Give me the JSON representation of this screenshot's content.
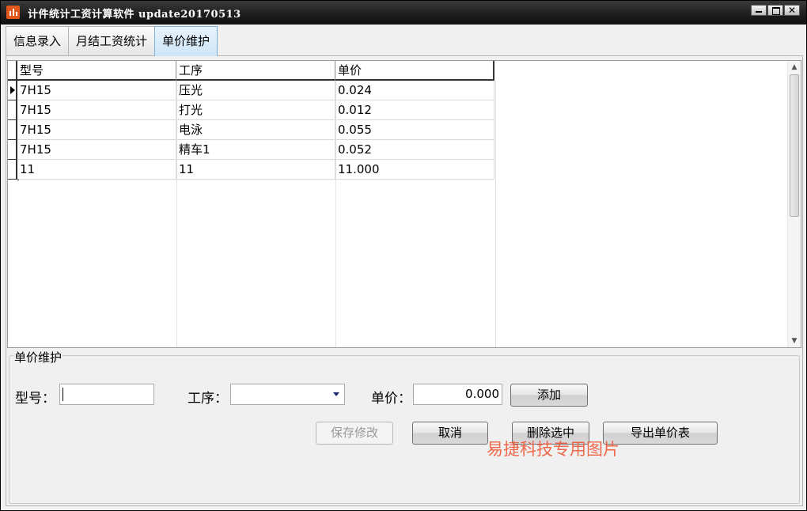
{
  "window": {
    "title": "计件统计工资计算软件  update20170513"
  },
  "tabs": [
    {
      "label": "信息录入",
      "active": false
    },
    {
      "label": "月结工资统计",
      "active": false
    },
    {
      "label": "单价维护",
      "active": true
    }
  ],
  "grid": {
    "columns": [
      "型号",
      "工序",
      "单价"
    ],
    "rows": [
      [
        "7H15",
        "压光",
        "0.024"
      ],
      [
        "7H15",
        "打光",
        "0.012"
      ],
      [
        "7H15",
        "电泳",
        "0.055"
      ],
      [
        "7H15",
        "精车1",
        "0.052"
      ],
      [
        "11",
        "11",
        "11.000"
      ]
    ],
    "current_row_index": 0
  },
  "form": {
    "group_title": "单价维护",
    "model_label": "型号：",
    "model_value": "",
    "process_label": "工序：",
    "process_value": "",
    "price_label": "单价：",
    "price_value": "0.000",
    "add_button": "添加",
    "save_button": "保存修改",
    "cancel_button": "取消",
    "delete_button": "删除选中",
    "export_button": "导出单价表"
  },
  "watermark": "易捷科技专用图片"
}
